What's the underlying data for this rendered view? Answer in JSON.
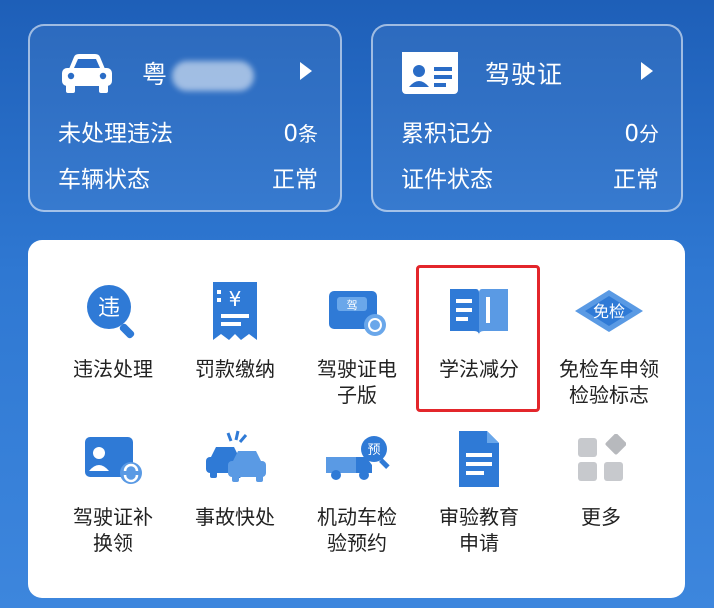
{
  "vehicle_card": {
    "plate_prefix": "粤",
    "plate_suffix": "",
    "rows": [
      {
        "label": "未处理违法",
        "value": "0",
        "unit": "条"
      },
      {
        "label": "车辆状态",
        "value": "正常",
        "unit": ""
      }
    ]
  },
  "license_card": {
    "title": "驾驶证",
    "rows": [
      {
        "label": "累积记分",
        "value": "0",
        "unit": "分"
      },
      {
        "label": "证件状态",
        "value": "正常",
        "unit": ""
      }
    ]
  },
  "services": [
    {
      "label": "违法处理",
      "icon": "violation-icon"
    },
    {
      "label": "罚款缴纳",
      "icon": "fine-payment-icon"
    },
    {
      "label": "驾驶证电\n子版",
      "icon": "e-license-icon"
    },
    {
      "label": "学法减分",
      "icon": "study-book-icon",
      "highlighted": true
    },
    {
      "label": "免检车申领\n检验标志",
      "icon": "exempt-inspection-icon"
    },
    {
      "label": "驾驶证补\n换领",
      "icon": "license-replace-icon"
    },
    {
      "label": "事故快处",
      "icon": "accident-icon"
    },
    {
      "label": "机动车检\n验预约",
      "icon": "inspection-booking-icon"
    },
    {
      "label": "审验教育\n申请",
      "icon": "document-icon"
    },
    {
      "label": "更多",
      "icon": "more-grid-icon"
    }
  ],
  "colors": {
    "brand_blue": "#2f7ad6",
    "highlight_red": "#e3262b"
  }
}
